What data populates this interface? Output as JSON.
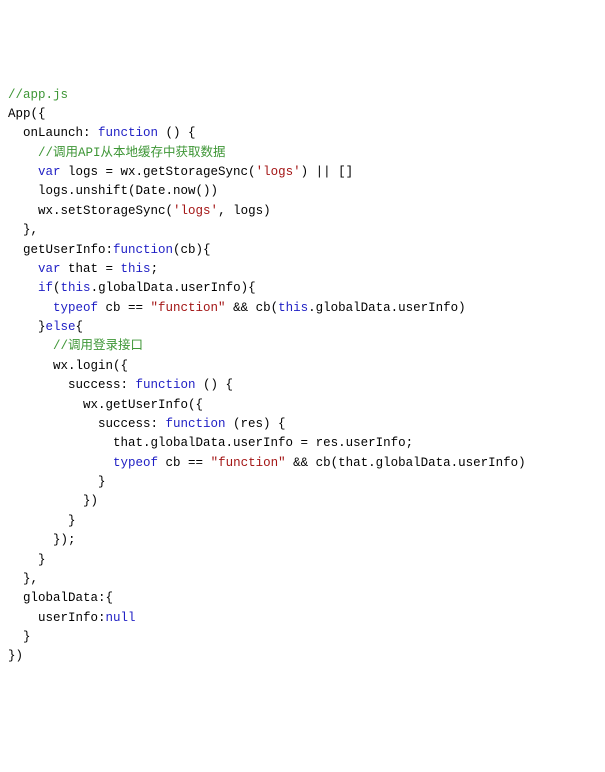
{
  "code": {
    "lines": [
      {
        "indent": 0,
        "segments": [
          {
            "cls": "comment",
            "text": "//app.js"
          }
        ]
      },
      {
        "indent": 0,
        "segments": [
          {
            "cls": "plain",
            "text": "App({"
          }
        ]
      },
      {
        "indent": 1,
        "segments": [
          {
            "cls": "plain",
            "text": "onLaunch: "
          },
          {
            "cls": "funckey",
            "text": "function"
          },
          {
            "cls": "plain",
            "text": " () {"
          }
        ]
      },
      {
        "indent": 2,
        "segments": [
          {
            "cls": "comment",
            "text": "//调用API从本地缓存中获取数据"
          }
        ]
      },
      {
        "indent": 2,
        "segments": [
          {
            "cls": "keyword",
            "text": "var"
          },
          {
            "cls": "plain",
            "text": " logs = wx.getStorageSync("
          },
          {
            "cls": "string",
            "text": "'logs'"
          },
          {
            "cls": "plain",
            "text": ") || []"
          }
        ]
      },
      {
        "indent": 2,
        "segments": [
          {
            "cls": "plain",
            "text": "logs.unshift(Date.now())"
          }
        ]
      },
      {
        "indent": 2,
        "segments": [
          {
            "cls": "plain",
            "text": "wx.setStorageSync("
          },
          {
            "cls": "string",
            "text": "'logs'"
          },
          {
            "cls": "plain",
            "text": ", logs)"
          }
        ]
      },
      {
        "indent": 1,
        "segments": [
          {
            "cls": "plain",
            "text": "},"
          }
        ]
      },
      {
        "indent": 1,
        "segments": [
          {
            "cls": "plain",
            "text": "getUserInfo:"
          },
          {
            "cls": "funckey",
            "text": "function"
          },
          {
            "cls": "plain",
            "text": "(cb){"
          }
        ]
      },
      {
        "indent": 2,
        "segments": [
          {
            "cls": "keyword",
            "text": "var"
          },
          {
            "cls": "plain",
            "text": " that = "
          },
          {
            "cls": "keyword",
            "text": "this"
          },
          {
            "cls": "plain",
            "text": ";"
          }
        ]
      },
      {
        "indent": 2,
        "segments": [
          {
            "cls": "keyword",
            "text": "if"
          },
          {
            "cls": "plain",
            "text": "("
          },
          {
            "cls": "keyword",
            "text": "this"
          },
          {
            "cls": "plain",
            "text": ".globalData.userInfo){"
          }
        ]
      },
      {
        "indent": 3,
        "segments": [
          {
            "cls": "keyword",
            "text": "typeof"
          },
          {
            "cls": "plain",
            "text": " cb == "
          },
          {
            "cls": "string",
            "text": "\"function\""
          },
          {
            "cls": "plain",
            "text": " && cb("
          },
          {
            "cls": "keyword",
            "text": "this"
          },
          {
            "cls": "plain",
            "text": ".globalData.userInfo)"
          }
        ]
      },
      {
        "indent": 2,
        "segments": [
          {
            "cls": "plain",
            "text": "}"
          },
          {
            "cls": "keyword",
            "text": "else"
          },
          {
            "cls": "plain",
            "text": "{"
          }
        ]
      },
      {
        "indent": 3,
        "segments": [
          {
            "cls": "comment",
            "text": "//调用登录接口"
          }
        ]
      },
      {
        "indent": 3,
        "segments": [
          {
            "cls": "plain",
            "text": "wx.login({"
          }
        ]
      },
      {
        "indent": 4,
        "segments": [
          {
            "cls": "plain",
            "text": "success: "
          },
          {
            "cls": "funckey",
            "text": "function"
          },
          {
            "cls": "plain",
            "text": " () {"
          }
        ]
      },
      {
        "indent": 5,
        "segments": [
          {
            "cls": "plain",
            "text": "wx.getUserInfo({"
          }
        ]
      },
      {
        "indent": 6,
        "segments": [
          {
            "cls": "plain",
            "text": "success: "
          },
          {
            "cls": "funckey",
            "text": "function"
          },
          {
            "cls": "plain",
            "text": " (res) {"
          }
        ]
      },
      {
        "indent": 7,
        "segments": [
          {
            "cls": "plain",
            "text": "that.globalData.userInfo = res.userInfo;"
          }
        ]
      },
      {
        "indent": 7,
        "segments": [
          {
            "cls": "keyword",
            "text": "typeof"
          },
          {
            "cls": "plain",
            "text": " cb == "
          },
          {
            "cls": "string",
            "text": "\"function\""
          },
          {
            "cls": "plain",
            "text": " && cb(that.globalData.userInfo)"
          }
        ]
      },
      {
        "indent": 6,
        "segments": [
          {
            "cls": "plain",
            "text": "}"
          }
        ]
      },
      {
        "indent": 5,
        "segments": [
          {
            "cls": "plain",
            "text": "})"
          }
        ]
      },
      {
        "indent": 4,
        "segments": [
          {
            "cls": "plain",
            "text": "}"
          }
        ]
      },
      {
        "indent": 3,
        "segments": [
          {
            "cls": "plain",
            "text": "});"
          }
        ]
      },
      {
        "indent": 2,
        "segments": [
          {
            "cls": "plain",
            "text": "}"
          }
        ]
      },
      {
        "indent": 1,
        "segments": [
          {
            "cls": "plain",
            "text": "},"
          }
        ]
      },
      {
        "indent": 1,
        "segments": [
          {
            "cls": "plain",
            "text": "globalData:{"
          }
        ]
      },
      {
        "indent": 2,
        "segments": [
          {
            "cls": "plain",
            "text": "userInfo:"
          },
          {
            "cls": "keyword",
            "text": "null"
          }
        ]
      },
      {
        "indent": 1,
        "segments": [
          {
            "cls": "plain",
            "text": "}"
          }
        ]
      },
      {
        "indent": 0,
        "segments": [
          {
            "cls": "plain",
            "text": "})"
          }
        ]
      }
    ]
  }
}
